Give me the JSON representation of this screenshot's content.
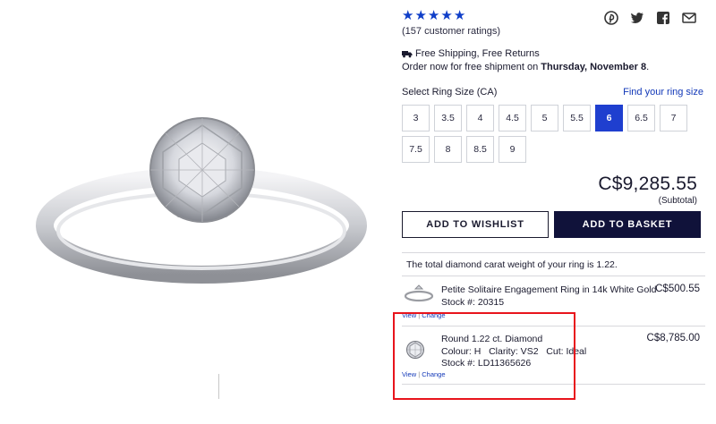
{
  "rating": {
    "stars": 5,
    "count_text": "(157 customer ratings)"
  },
  "share_icons": [
    "pinterest-icon",
    "twitter-icon",
    "facebook-icon",
    "email-icon"
  ],
  "shipping": {
    "title": "Free Shipping, Free Returns",
    "order_prefix": "Order now for free shipment on ",
    "order_date": "Thursday, November 8",
    "order_suffix": "."
  },
  "ring_size": {
    "label": "Select Ring Size (CA)",
    "find_link": "Find your ring size",
    "sizes": [
      "3",
      "3.5",
      "4",
      "4.5",
      "5",
      "5.5",
      "6",
      "6.5",
      "7",
      "7.5",
      "8",
      "8.5",
      "9"
    ],
    "selected": "6"
  },
  "price": {
    "amount": "C$9,285.55",
    "note": "(Subtotal)"
  },
  "buttons": {
    "wishlist": "ADD TO WISHLIST",
    "basket": "ADD TO BASKET"
  },
  "total_carat_text": "The total diamond carat weight of your ring is 1.22.",
  "items": [
    {
      "title": "Petite Solitaire Engagement Ring in 14k White Gold",
      "stock": "Stock #: 20315",
      "price": "C$500.55",
      "view_label": "View",
      "change_label": "Change"
    },
    {
      "title": "Round 1.22 ct. Diamond",
      "specs": "Colour: H   Clarity: VS2   Cut: Ideal",
      "stock": "Stock #: LD11365626",
      "price": "C$8,785.00",
      "view_label": "View",
      "change_label": "Change"
    }
  ],
  "colors": {
    "accent": "#1f3fcf",
    "dark_button": "#10123a",
    "highlight": "#e8141c",
    "star": "#0f3ec8"
  }
}
